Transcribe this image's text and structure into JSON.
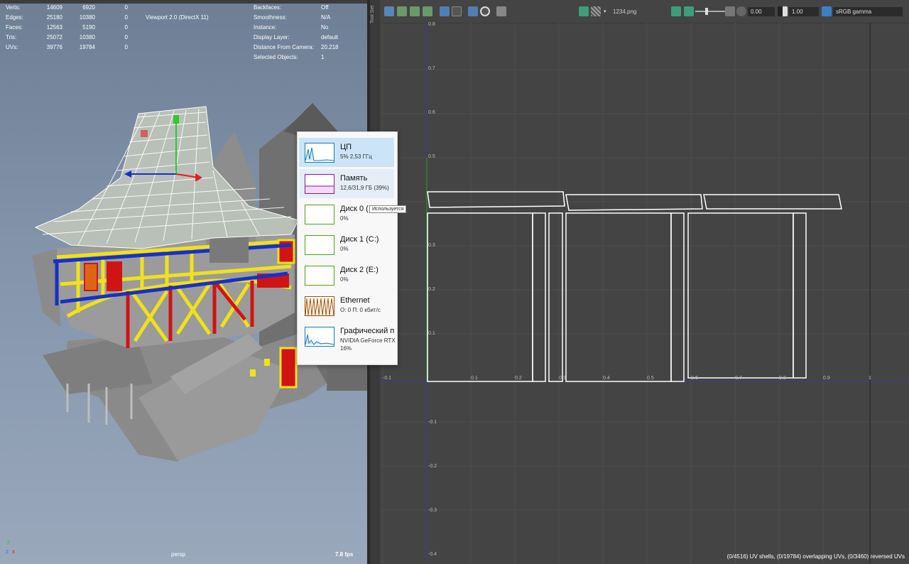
{
  "viewport": {
    "stats": [
      {
        "label": "Verts:",
        "v1": "14609",
        "v2": "6920",
        "v3": "0"
      },
      {
        "label": "Edges:",
        "v1": "25180",
        "v2": "10380",
        "v3": "0"
      },
      {
        "label": "Faces:",
        "v1": "12563",
        "v2": "5190",
        "v3": "0"
      },
      {
        "label": "Tris:",
        "v1": "25072",
        "v2": "10380",
        "v3": "0"
      },
      {
        "label": "UVs:",
        "v1": "39776",
        "v2": "19784",
        "v3": "0"
      }
    ],
    "renderer": "Viewport 2.0 (DirectX 11)",
    "info": [
      {
        "label": "Backfaces:",
        "value": "Off"
      },
      {
        "label": "Smoothness:",
        "value": "N/A"
      },
      {
        "label": "Instance:",
        "value": "No"
      },
      {
        "label": "Display Layer:",
        "value": "default"
      },
      {
        "label": "Distance From Camera:",
        "value": "20.218"
      },
      {
        "label": "Selected Objects:",
        "value": "1"
      }
    ],
    "camera": "persp",
    "fps": "7.8 fps",
    "axis_labels": {
      "y": "y",
      "x": "x",
      "z": "z"
    }
  },
  "tool_strip_label": "Tool Set",
  "uv_editor": {
    "texture_name": "1234.png",
    "exposure": "0.00",
    "gamma": "1.00",
    "color_space": "sRGB gamma",
    "status": "(0/4516) UV shells, (0/19784) overlapping UVs, (0/3460) reversed UVs",
    "axis": {
      "x_ticks": [
        "-0.1",
        "0.1",
        "0.2",
        "0.3",
        "0.4",
        "0.5",
        "0.6",
        "0.7",
        "0.8",
        "0.9",
        "1"
      ],
      "y_ticks": [
        "0.8",
        "0.7",
        "0.6",
        "0.5",
        "0.3",
        "0.2",
        "0.1",
        "-0.1",
        "-0.2",
        "-0.3",
        "-0.4"
      ]
    }
  },
  "task_manager": {
    "items": [
      {
        "name": "ЦП",
        "sub": "5%  2,53 ГГц",
        "sub2": "",
        "icon": "cpu-graph-icon",
        "color": "#117dbb"
      },
      {
        "name": "Память",
        "sub": "12,6/31,9 ГБ (39%)",
        "sub2": "",
        "icon": "memory-graph-icon",
        "color": "#8b12ae"
      },
      {
        "name": "Диск 0 (",
        "sub": "0%",
        "sub2": "",
        "icon": "disk0-graph-icon",
        "color": "#4da60c"
      },
      {
        "name": "Диск 1 (C:)",
        "sub": "0%",
        "sub2": "",
        "icon": "disk1-graph-icon",
        "color": "#4da60c"
      },
      {
        "name": "Диск 2 (E:)",
        "sub": "0%",
        "sub2": "",
        "icon": "disk2-graph-icon",
        "color": "#4da60c"
      },
      {
        "name": "Ethernet",
        "sub": "О: 0  П: 0 кбит/с",
        "sub2": "",
        "icon": "ethernet-graph-icon",
        "color": "#a74f01"
      },
      {
        "name": "Графический п",
        "sub": "NVIDIA GeForce RTX",
        "sub2": "16%",
        "icon": "gpu-graph-icon",
        "color": "#117dbb"
      }
    ],
    "tooltip": "Используется"
  }
}
